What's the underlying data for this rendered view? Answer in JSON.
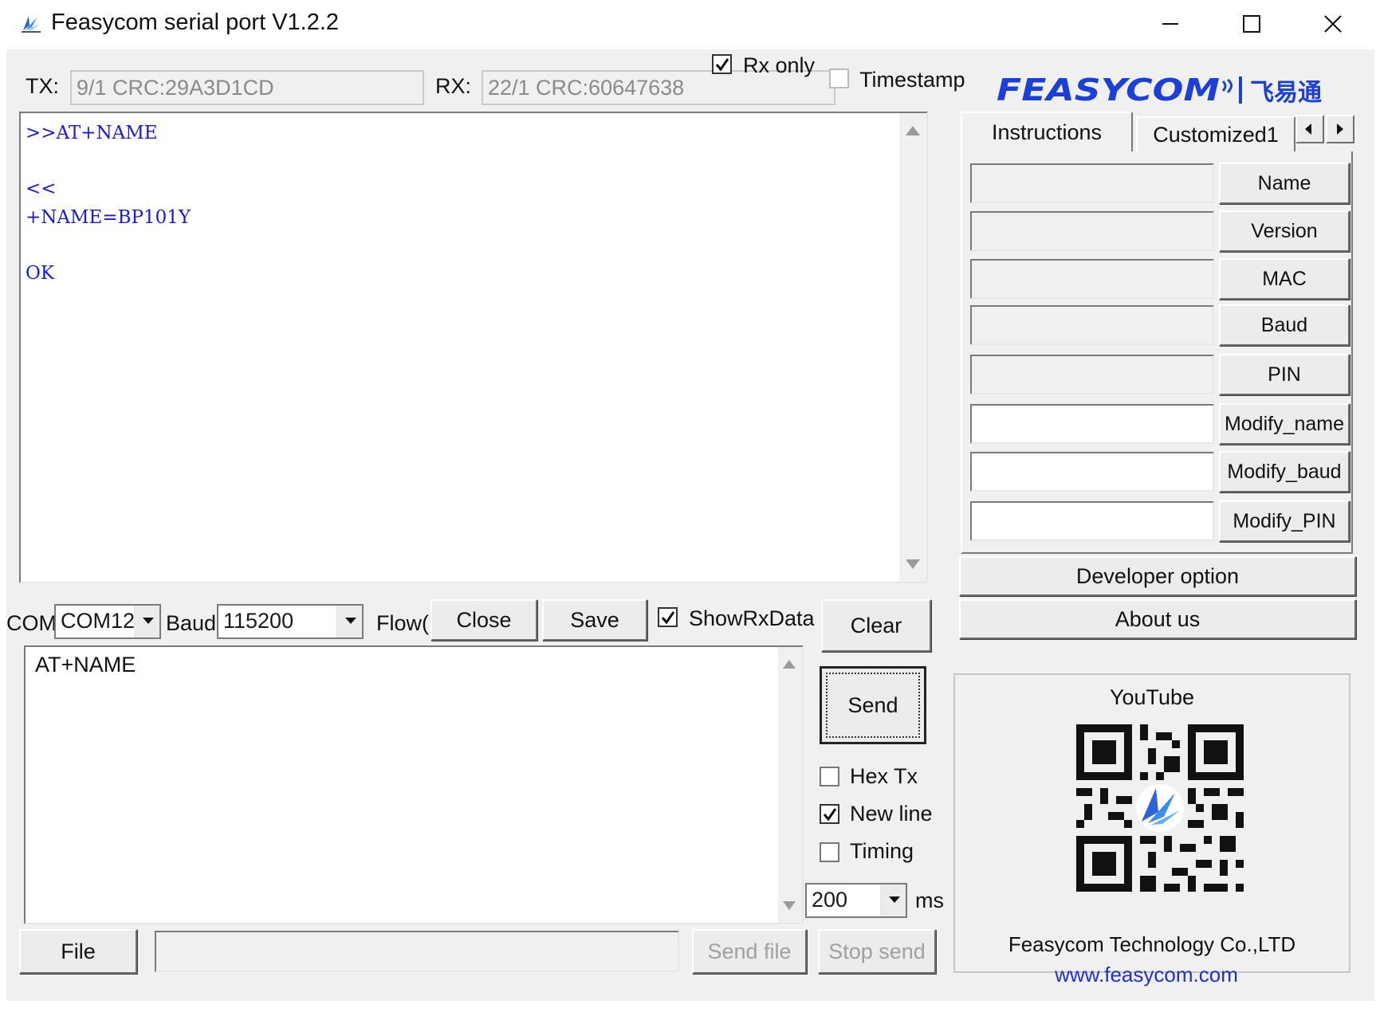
{
  "window": {
    "title": "Feasycom serial port V1.2.2",
    "controls": {
      "minimize": "—",
      "maximize": "☐",
      "close": "✕"
    }
  },
  "status": {
    "tx_label": "TX:",
    "tx_value": "9/1 CRC:29A3D1CD",
    "rx_label": "RX:",
    "rx_value": "22/1 CRC:60647638",
    "rx_only_label": "Rx only",
    "rx_only_checked": true,
    "timestamp_label": "Timestamp",
    "timestamp_checked": false
  },
  "receive": {
    "lines": [
      ">>AT+NAME",
      "<<",
      "+NAME=BP101Y",
      "OK"
    ],
    "text_color": "#1a1adf"
  },
  "port": {
    "com_label": "COM",
    "com_value": "COM12",
    "baud_label": "Baud",
    "baud_value": "115200",
    "flow_label": "Flow(",
    "close_label": "Close",
    "save_label": "Save",
    "show_rx_label": "ShowRxData",
    "show_rx_checked": true,
    "clear_label": "Clear"
  },
  "send": {
    "text": "AT+NAME",
    "send_label": "Send",
    "hex_tx_label": "Hex Tx",
    "hex_tx_checked": false,
    "new_line_label": "New line",
    "new_line_checked": true,
    "timing_label": "Timing",
    "timing_checked": false,
    "interval_value": "200",
    "interval_unit": "ms",
    "file_label": "File",
    "file_path": "",
    "send_file_label": "Send file",
    "stop_send_label": "Stop send"
  },
  "brand": {
    "logo_text": "FEASYCOM",
    "logo_cn": "飞易通",
    "logo_color": "#1b3fd8"
  },
  "tabs": [
    {
      "label": "Instructions",
      "active": true
    },
    {
      "label": "Customized1",
      "active": false
    }
  ],
  "commands": [
    {
      "value": "",
      "button": "Name"
    },
    {
      "value": "",
      "button": "Version"
    },
    {
      "value": "",
      "button": "MAC"
    },
    {
      "value": "",
      "button": "Baud"
    },
    {
      "value": "",
      "button": "PIN"
    },
    {
      "value": "",
      "button": "Modify_name"
    },
    {
      "value": "",
      "button": "Modify_baud"
    },
    {
      "value": "",
      "button": "Modify_PIN"
    }
  ],
  "developer_option_label": "Developer option",
  "about_us_label": "About us",
  "promo": {
    "youtube_label": "YouTube",
    "company": "Feasycom Technology Co.,LTD",
    "website": "www.feasycom.com",
    "link_color": "#1f2fd0"
  }
}
